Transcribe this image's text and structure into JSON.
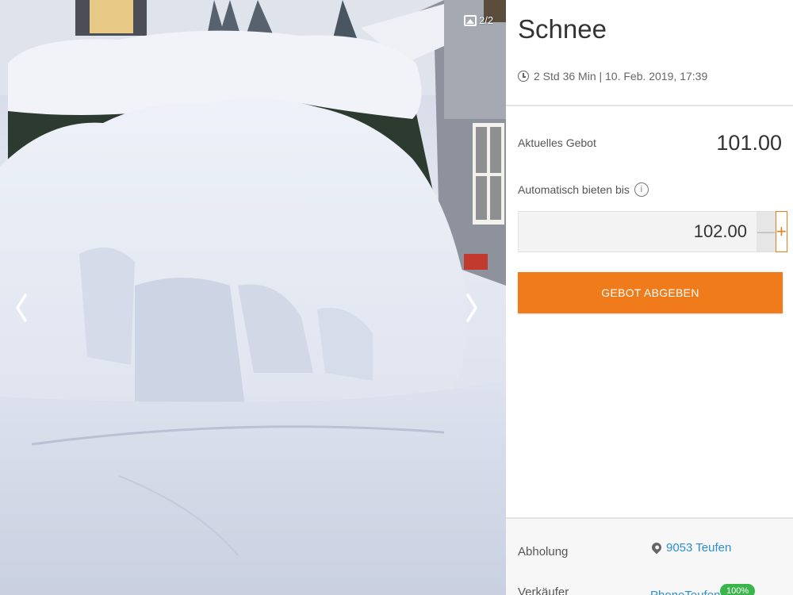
{
  "listing": {
    "title": "Schnee",
    "time_remaining": "2 Std 36 Min | 10. Feb. 2019, 17:39"
  },
  "gallery": {
    "counter": "2/2",
    "counter_icon": "image-icon",
    "prev_icon": "chevron-left-icon",
    "next_icon": "chevron-right-icon"
  },
  "bidding": {
    "current_bid_label": "Aktuelles Gebot",
    "current_bid_value": "101.00",
    "auto_bid_label": "Automatisch bieten bis",
    "auto_bid_value": "102.00",
    "minus_label": "—",
    "plus_label": "+",
    "submit_label": "GEBOT ABGEBEN",
    "accent_color": "#f07b1a"
  },
  "details": {
    "pickup_label": "Abholung",
    "pickup_value": "9053 Teufen",
    "seller_label": "Verkäufer",
    "seller_name": "PhoneTeufen",
    "seller_badge": "100%"
  }
}
